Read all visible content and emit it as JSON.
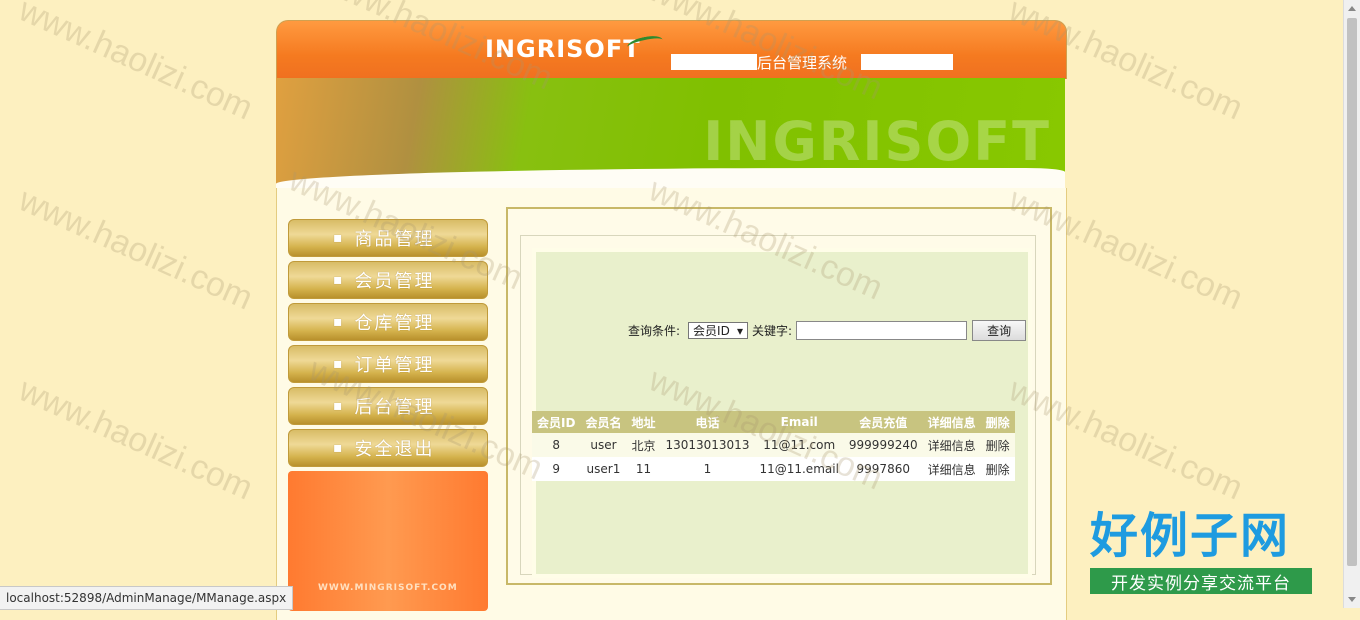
{
  "header": {
    "logo": "INGRISOFT",
    "system_title": "后台管理系统",
    "banner_watermark": "INGRISOFT"
  },
  "sidebar": {
    "items": [
      {
        "label": "商品管理"
      },
      {
        "label": "会员管理"
      },
      {
        "label": "仓库管理"
      },
      {
        "label": "订单管理"
      },
      {
        "label": "后台管理"
      },
      {
        "label": "安全退出"
      }
    ],
    "footer_url": "WWW.MINGRISOFT.COM"
  },
  "search": {
    "condition_label": "查询条件:",
    "condition_selected": "会员ID",
    "keyword_label": "关键字:",
    "keyword_value": "",
    "button_label": "查询"
  },
  "table": {
    "headers": [
      "会员ID",
      "会员名",
      "地址",
      "电话",
      "Email",
      "会员充值",
      "详细信息",
      "删除"
    ],
    "rows": [
      [
        "8",
        "user",
        "北京",
        "13013013013",
        "11@11.com",
        "999999240",
        "详细信息",
        "删除"
      ],
      [
        "9",
        "user1",
        "11",
        "1",
        "11@11.email",
        "9997860",
        "详细信息",
        "删除"
      ]
    ]
  },
  "status_bar": {
    "url": "localhost:52898/AdminManage/MManage.aspx"
  },
  "watermark": {
    "text": "www.haolizi.com"
  },
  "brand": {
    "main": "好例子网",
    "sub": "开发实例分享交流平台"
  },
  "colors": {
    "page_bg": "#fdf0c0",
    "header_orange": "#f57a20",
    "banner_green": "#80c000",
    "menu_gold": "#d4b24c",
    "panel_green": "#e9f0cc",
    "table_header": "#c8c480",
    "brand_blue": "#1e9be0",
    "brand_green": "#2e9a4a"
  }
}
